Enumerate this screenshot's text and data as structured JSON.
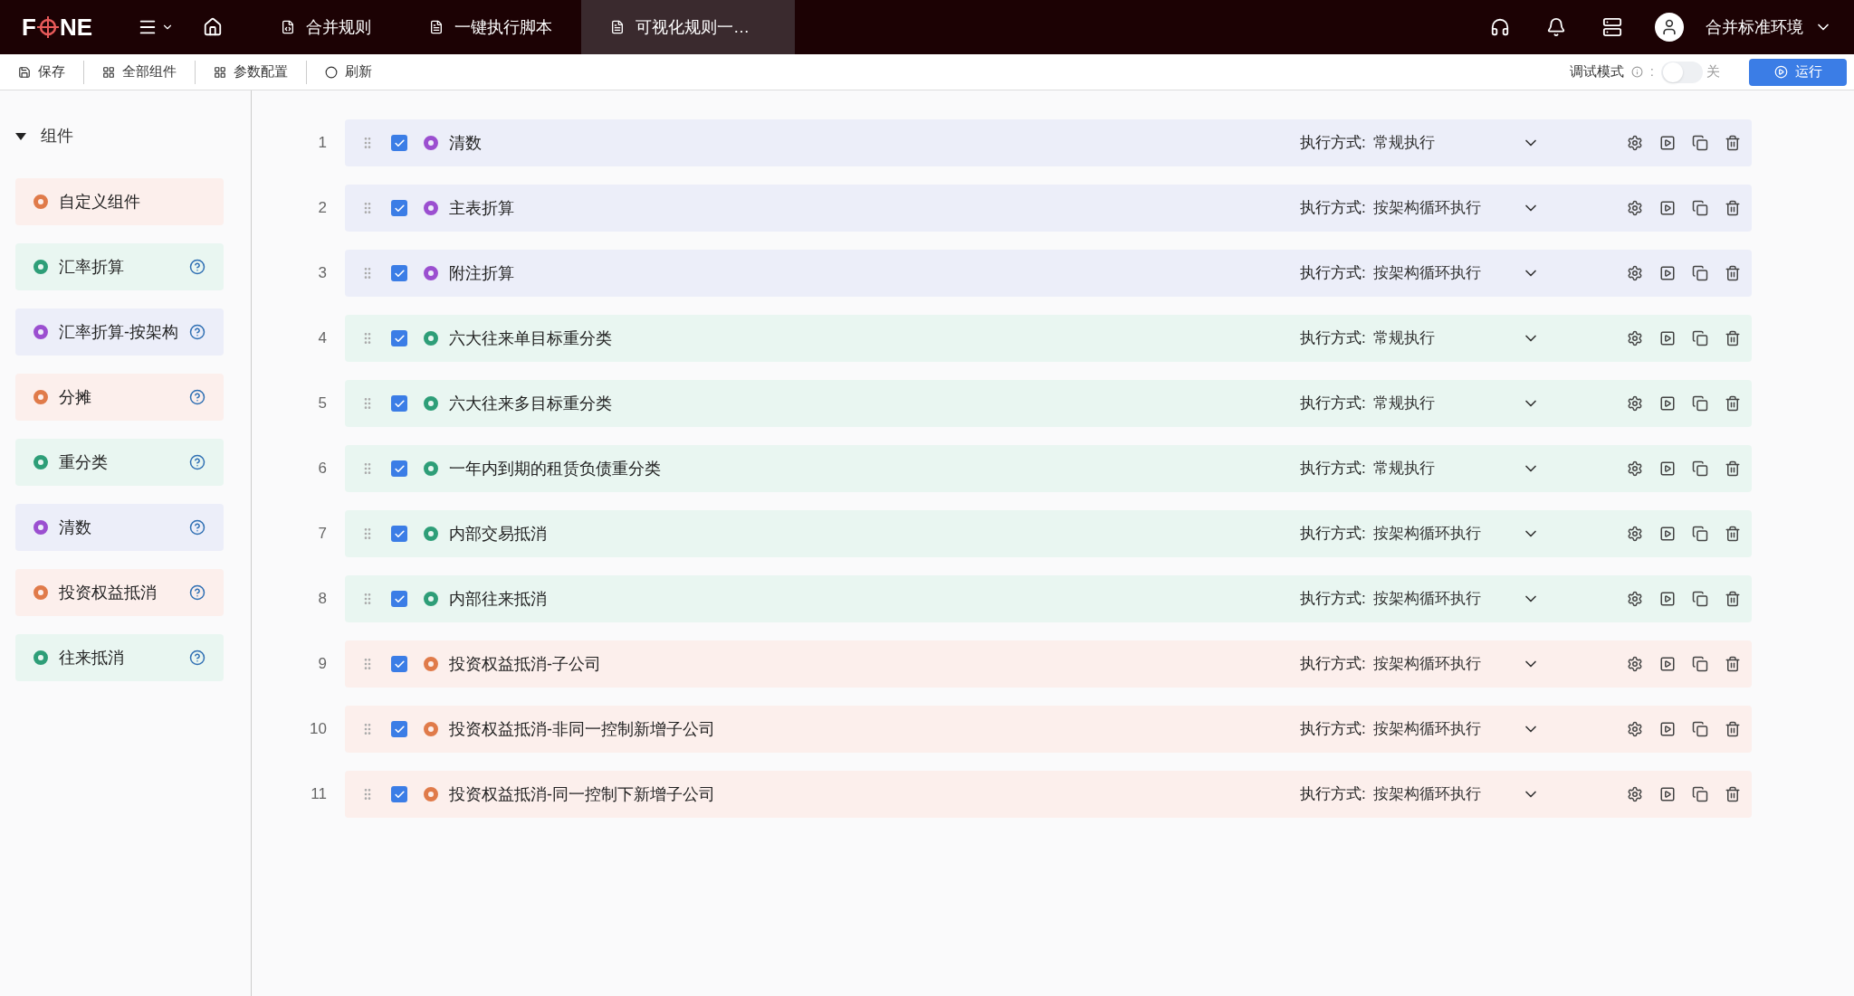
{
  "header": {
    "logo": "F",
    "logo_end": "NE",
    "tabs": [
      {
        "label": "合并规则",
        "selected": false
      },
      {
        "label": "一键执行脚本",
        "selected": false
      },
      {
        "label": "可视化规则一…",
        "selected": true
      }
    ],
    "environment": "合并标准环境"
  },
  "toolbar": {
    "buttons": [
      "保存",
      "全部组件",
      "参数配置",
      "刷新"
    ],
    "debug_label": "调试模式",
    "debug_colon": ":",
    "debug_on": false,
    "debug_state": "关",
    "run": "运行"
  },
  "sidebar": {
    "title": "组件",
    "expanded": true,
    "items": [
      {
        "label": "自定义组件",
        "color": "#e07b4a",
        "help": false
      },
      {
        "label": "汇率折算",
        "color": "#2e9e78",
        "help": true
      },
      {
        "label": "汇率折算-按架构",
        "color": "#9b4fd0",
        "help": true
      },
      {
        "label": "分摊",
        "color": "#e07b4a",
        "help": true
      },
      {
        "label": "重分类",
        "color": "#2e9e78",
        "help": true
      },
      {
        "label": "清数",
        "color": "#9b4fd0",
        "help": true
      },
      {
        "label": "投资权益抵消",
        "color": "#e07b4a",
        "help": true
      },
      {
        "label": "往来抵消",
        "color": "#2e9e78",
        "help": true
      }
    ]
  },
  "rows": [
    {
      "index": "1",
      "name": "清数",
      "color": "#9b4fd0",
      "checked": true,
      "mode_label": "执行方式:",
      "mode": "常规执行"
    },
    {
      "index": "2",
      "name": "主表折算",
      "color": "#9b4fd0",
      "checked": true,
      "mode_label": "执行方式:",
      "mode": "按架构循环执行"
    },
    {
      "index": "3",
      "name": "附注折算",
      "color": "#9b4fd0",
      "checked": true,
      "mode_label": "执行方式:",
      "mode": "按架构循环执行"
    },
    {
      "index": "4",
      "name": "六大往来单目标重分类",
      "color": "#2e9e78",
      "checked": true,
      "mode_label": "执行方式:",
      "mode": "常规执行"
    },
    {
      "index": "5",
      "name": "六大往来多目标重分类",
      "color": "#2e9e78",
      "checked": true,
      "mode_label": "执行方式:",
      "mode": "常规执行"
    },
    {
      "index": "6",
      "name": "一年内到期的租赁负债重分类",
      "color": "#2e9e78",
      "checked": true,
      "mode_label": "执行方式:",
      "mode": "常规执行"
    },
    {
      "index": "7",
      "name": "内部交易抵消",
      "color": "#2e9e78",
      "checked": true,
      "mode_label": "执行方式:",
      "mode": "按架构循环执行"
    },
    {
      "index": "8",
      "name": "内部往来抵消",
      "color": "#2e9e78",
      "checked": true,
      "mode_label": "执行方式:",
      "mode": "按架构循环执行"
    },
    {
      "index": "9",
      "name": "投资权益抵消-子公司",
      "color": "#e07b4a",
      "checked": true,
      "mode_label": "执行方式:",
      "mode": "按架构循环执行"
    },
    {
      "index": "10",
      "name": "投资权益抵消-非同一控制新增子公司",
      "color": "#e07b4a",
      "checked": true,
      "mode_label": "执行方式:",
      "mode": "按架构循环执行"
    },
    {
      "index": "11",
      "name": "投资权益抵消-同一控制下新增子公司",
      "color": "#e07b4a",
      "checked": true,
      "mode_label": "执行方式:",
      "mode": "按架构循环执行"
    }
  ]
}
